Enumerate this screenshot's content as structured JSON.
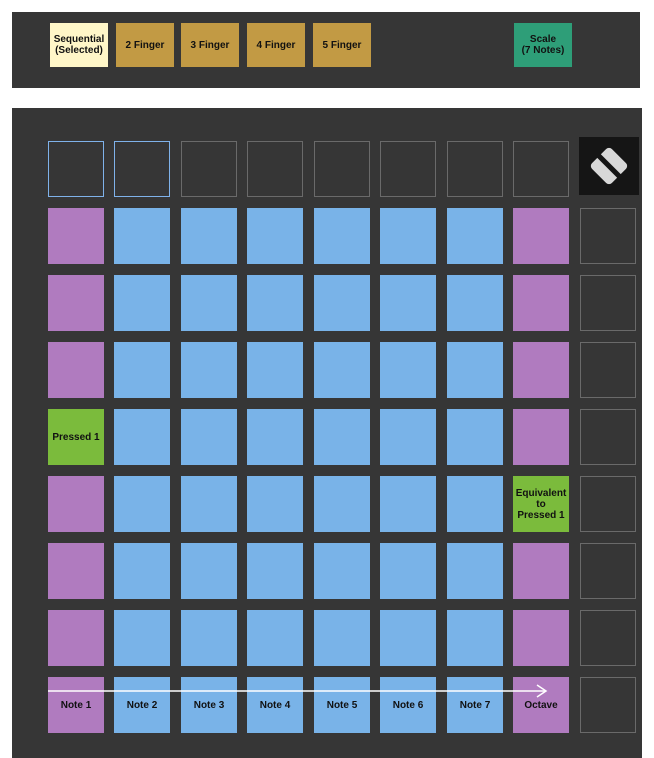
{
  "modes": [
    {
      "label": "Sequential\n(Selected)",
      "state": "selected"
    },
    {
      "label": "2 Finger",
      "state": "normal"
    },
    {
      "label": "3 Finger",
      "state": "normal"
    },
    {
      "label": "4 Finger",
      "state": "normal"
    },
    {
      "label": "5 Finger",
      "state": "normal"
    },
    {
      "label": "Scale\n(7 Notes)",
      "state": "scale"
    }
  ],
  "pads": {
    "pressed": "Pressed 1",
    "equivalent": "Equivalent\nto\nPressed 1",
    "bottom_row": [
      "Note 1",
      "Note 2",
      "Note 3",
      "Note 4",
      "Note 5",
      "Note 6",
      "Note 7",
      "Octave"
    ]
  },
  "colors": {
    "note_pad": "#79b3e8",
    "root_pad": "#b07bbf",
    "pressed_pad": "#7bbb3c",
    "selected_mode": "#fff6c8",
    "finger_mode": "#c29a44",
    "scale_mode": "#2e9e78"
  },
  "logo_icon": "novation-logo-icon"
}
